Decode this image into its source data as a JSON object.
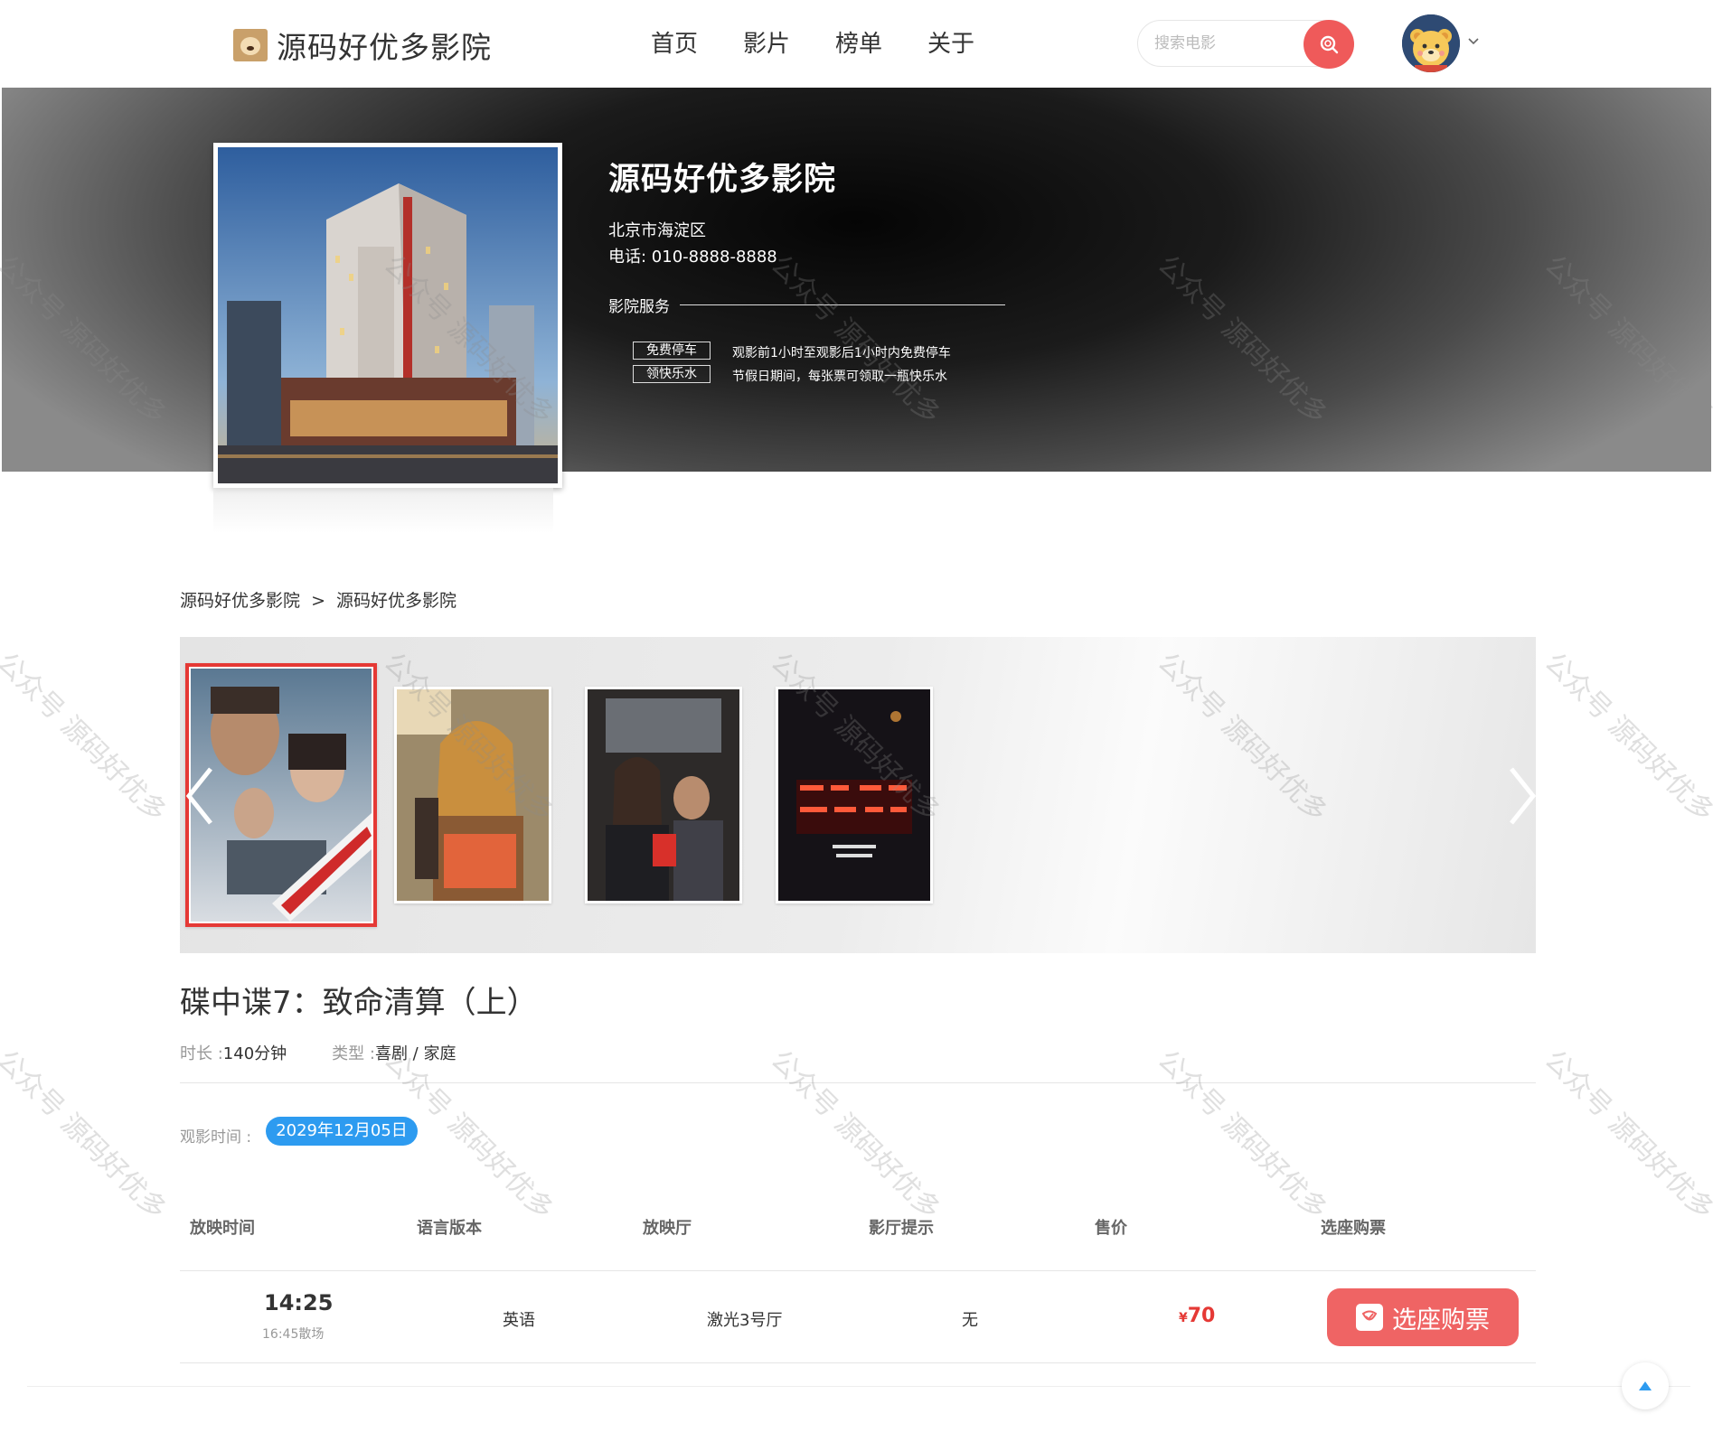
{
  "header": {
    "logo_text": "源码好优多影院",
    "nav": [
      "首页",
      "影片",
      "榜单",
      "关于"
    ],
    "search_placeholder": "搜索电影"
  },
  "cinema": {
    "name": "源码好优多影院",
    "address": "北京市海淀区",
    "phone": "电话: 010-8888-8888",
    "services_title": "影院服务",
    "services": [
      {
        "tag": "免费停车",
        "desc": "观影前1小时至观影后1小时内免费停车"
      },
      {
        "tag": "领快乐水",
        "desc": "节假日期间，每张票可领取一瓶快乐水"
      }
    ]
  },
  "breadcrumb": [
    "源码好优多影院",
    ">",
    "源码好优多影院"
  ],
  "movie": {
    "title": "碟中谍7：致命清算（上）",
    "duration_label": "时长 : ",
    "duration": "140分钟",
    "genre_label": "类型 : ",
    "genre": "喜剧 / 家庭",
    "date_label": "观影时间 :",
    "date": "2029年12月05日"
  },
  "schedule": {
    "headers": [
      "放映时间",
      "语言版本",
      "放映厅",
      "影厅提示",
      "售价",
      "选座购票"
    ],
    "rows": [
      {
        "start": "14:25",
        "end": "16:45散场",
        "language": "英语",
        "hall": "激光3号厅",
        "note": "无",
        "currency": "¥",
        "price": "70",
        "buy_label": "选座购票"
      }
    ]
  },
  "watermark": "公众号 源码好优多",
  "colors": {
    "accent": "#ef6464",
    "price": "#e53935",
    "date_chip": "#2d9bf0",
    "search_btn": "#ef5a5a"
  }
}
